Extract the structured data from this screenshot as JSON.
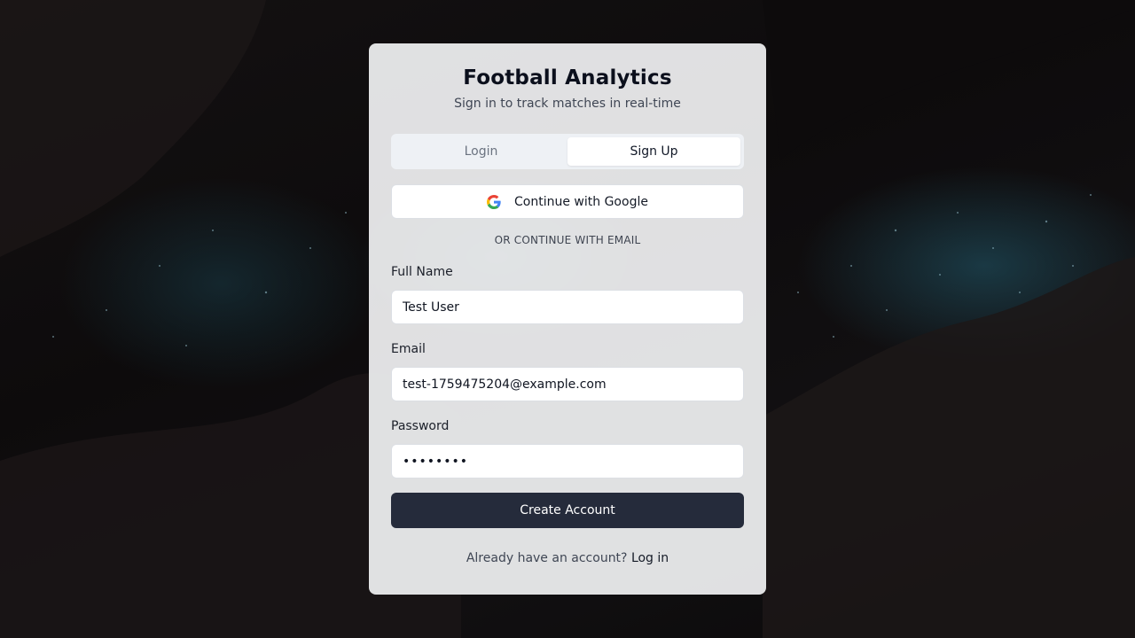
{
  "app": {
    "title": "Football Analytics",
    "subtitle": "Sign in to track matches in real-time"
  },
  "tabs": [
    {
      "label": "Login",
      "active": false
    },
    {
      "label": "Sign Up",
      "active": true
    }
  ],
  "google": {
    "label": "Continue with Google",
    "icon": "google-icon"
  },
  "divider": {
    "label": "OR CONTINUE WITH EMAIL"
  },
  "form": {
    "full_name": {
      "label": "Full Name",
      "value": "Test User"
    },
    "email": {
      "label": "Email",
      "value": "test-1759475204@example.com"
    },
    "password": {
      "label": "Password",
      "value": "••••••••"
    }
  },
  "submit": {
    "label": "Create Account"
  },
  "footer": {
    "prompt": "Already have an account?",
    "link": "Log in"
  },
  "colors": {
    "primary": "#252b3b",
    "card": "#f0f1f2"
  }
}
